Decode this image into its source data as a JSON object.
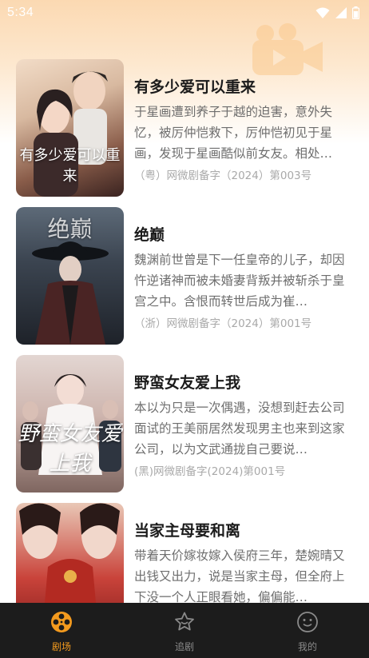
{
  "status_bar": {
    "time": "5:34"
  },
  "colors": {
    "accent": "#f39a1e",
    "tabbar_bg": "#1c1c1c",
    "title": "#1b1b1b",
    "desc": "#6e6e6e",
    "license": "#a9a9a9"
  },
  "dramas": [
    {
      "title": "有多少爱可以重来",
      "description": "于星画遭到养子于越的迫害，意外失忆，被厉仲恺救下，厉仲恺初见于星画，发现于星画酷似前女友。相处…",
      "license": "（粤）网微剧备字（2024）第003号",
      "poster_text": "有多少爱可以重来"
    },
    {
      "title": "绝巅",
      "description": "魏渊前世曾是下一任皇帝的儿子，却因忤逆诸神而被未婚妻背叛并被斩杀于皇宫之中。含恨而转世后成为崔…",
      "license": "（浙）网微剧备字（2024）第001号",
      "poster_text": "绝巅"
    },
    {
      "title": "野蛮女友爱上我",
      "description": "本以为只是一次偶遇，没想到赶去公司面试的王美丽居然发现男主也来到这家公司，以为文武通拢自己要说…",
      "license": "(黑)网微剧备字(2024)第001号",
      "poster_text": "野蛮女友爱上我"
    },
    {
      "title": "当家主母要和离",
      "description": "带着天价嫁妆嫁入侯府三年，楚婉晴又出钱又出力，说是当家主母，但全府上下没一个人正眼看她，偏偏能…",
      "license": "",
      "poster_text": ""
    }
  ],
  "tabbar": {
    "tabs": [
      {
        "label": "剧场",
        "icon": "film-reel-icon",
        "active": true
      },
      {
        "label": "追剧",
        "icon": "star-icon",
        "active": false
      },
      {
        "label": "我的",
        "icon": "face-icon",
        "active": false
      }
    ]
  }
}
